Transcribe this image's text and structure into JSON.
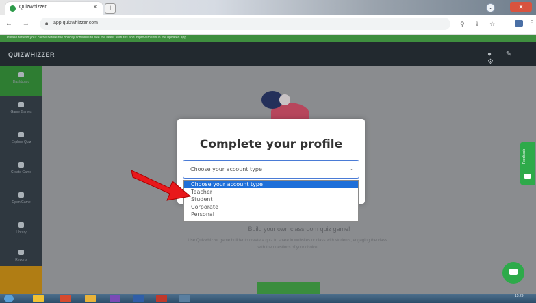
{
  "browser": {
    "tab_title": "QuizWhizzer",
    "tab_close": "×",
    "new_tab": "+",
    "url": "app.quizwhizzer.com",
    "nav_icons": "← → C",
    "ext_icons": "⚲ ⇪ ☆"
  },
  "app": {
    "announcement": "Please refresh your cache before the holiday schedule to see the latest features and improvements in the updated app",
    "brand": "QUIZWHIZZER",
    "header_icons": "● ✎ ⚙",
    "sidebar": [
      {
        "label": "Dashboard"
      },
      {
        "label": "Game Games"
      },
      {
        "label": "Explore Quiz"
      },
      {
        "label": "Create Game"
      },
      {
        "label": "Open Game"
      },
      {
        "label": "Library"
      },
      {
        "label": "Reports"
      }
    ],
    "background_heading": "Build your own classroom quiz game!",
    "background_text": "Use Quizwhizzer game builder to create a quiz to share in websites or class with students, engaging the class with the questions of your choice",
    "feedback_label": "Feedback"
  },
  "modal": {
    "title": "Complete your profile",
    "select_value": "Choose your account type",
    "select_chevron": "⌄",
    "options": [
      "Choose your account type",
      "Teacher",
      "Student",
      "Corporate",
      "Personal"
    ],
    "selected_index": 0
  },
  "taskbar": {
    "time": "15:29"
  },
  "colors": {
    "accent_green": "#2eaa4a",
    "header_dark": "#22292f",
    "select_highlight": "#1e6fd9",
    "arrow_red": "#e8181b"
  }
}
